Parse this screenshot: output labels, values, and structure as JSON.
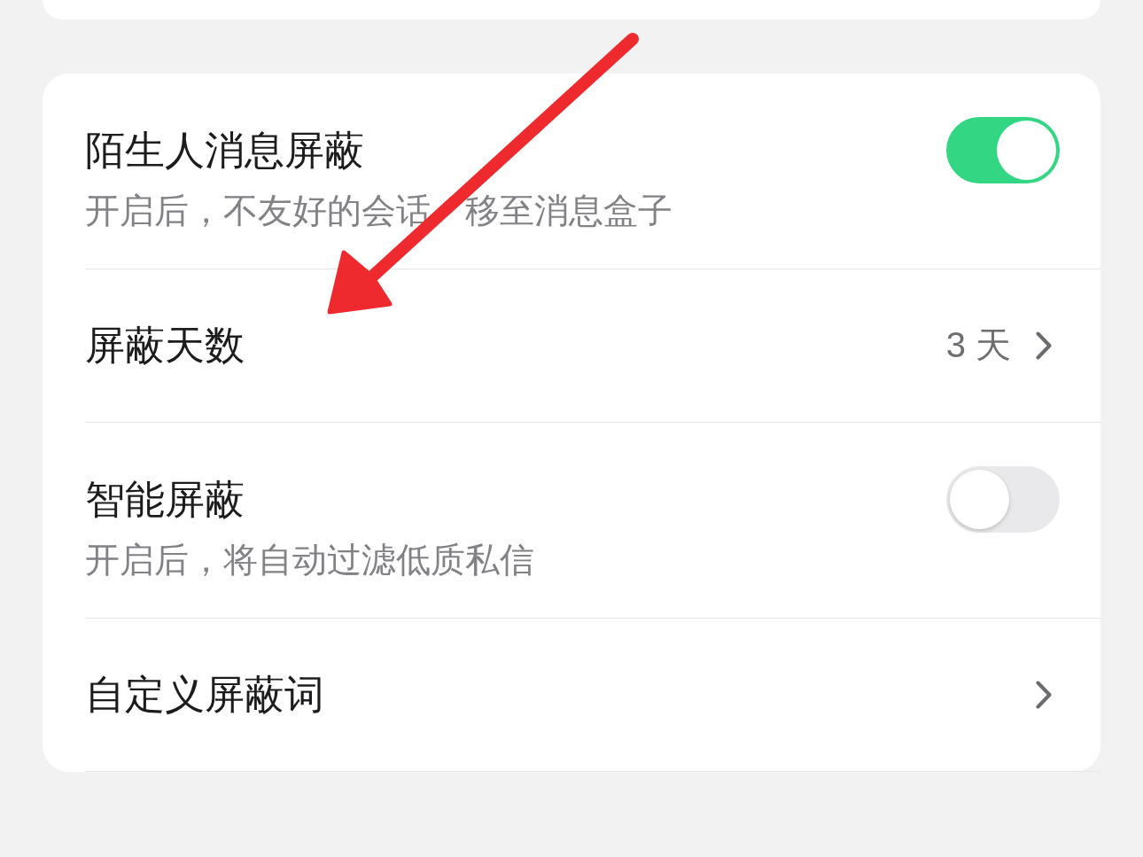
{
  "rows": [
    {
      "kind": "toggle",
      "title": "陌生人消息屏蔽",
      "subtitle_parts": [
        "开启后，不友好的会话",
        "移至消息盒子"
      ],
      "on": true
    },
    {
      "kind": "link",
      "title": "屏蔽天数",
      "value": "3 天"
    },
    {
      "kind": "toggle",
      "title": "智能屏蔽",
      "subtitle_parts": [
        "开启后，将自动过滤低质私信"
      ],
      "on": false
    },
    {
      "kind": "link",
      "title": "自定义屏蔽词"
    }
  ]
}
